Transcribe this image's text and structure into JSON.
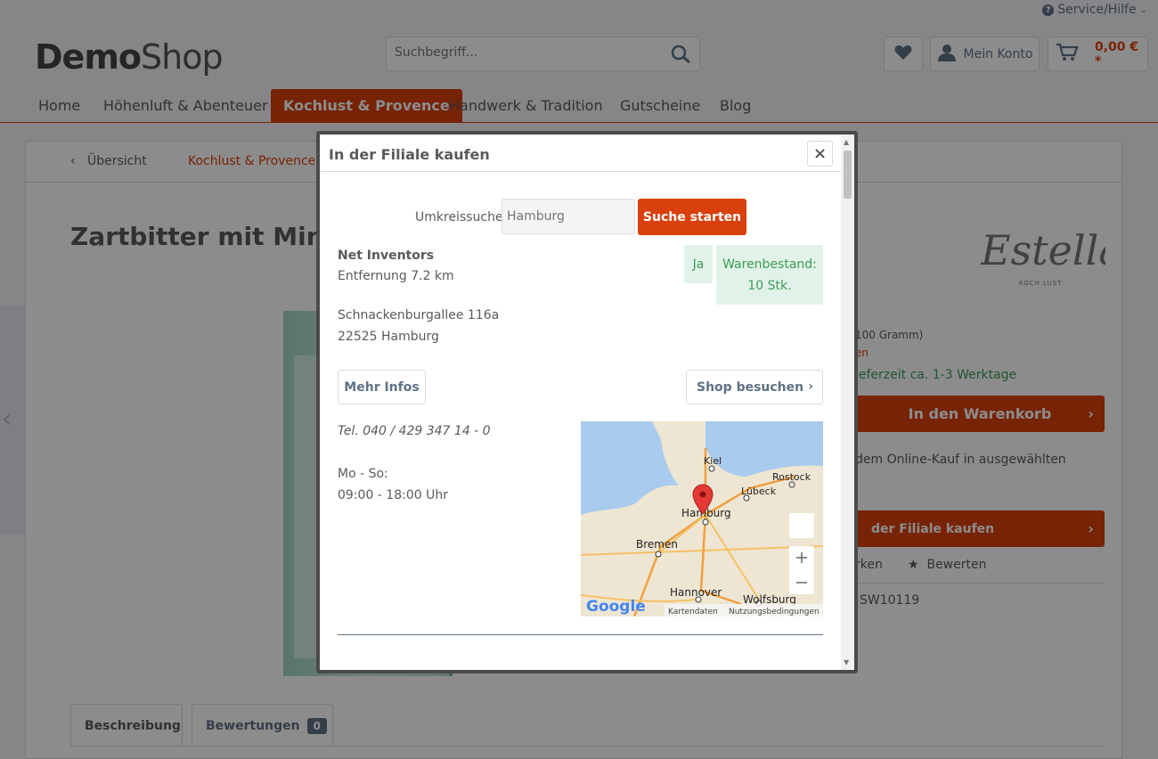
{
  "header": {
    "service_label": "Service/Hilfe",
    "logo_bold": "Demo",
    "logo_light": "Shop",
    "search_placeholder": "Suchbegriff...",
    "account_label": "Mein Konto",
    "cart_amount": "0,00 € *"
  },
  "nav": {
    "items": [
      {
        "label": "Home"
      },
      {
        "label": "Höhenluft & Abenteuer"
      },
      {
        "label": "Kochlust & Provence"
      },
      {
        "label": "Handwerk & Tradition"
      },
      {
        "label": "Gutscheine"
      },
      {
        "label": "Blog"
      }
    ],
    "active_index": 2
  },
  "breadcrumb": {
    "back_label": "Übersicht",
    "category": "Kochlust & Provence"
  },
  "product": {
    "title_visible": "Zartbitter mit Minze",
    "brand_logo_text": "Estella",
    "brand_logo_sub": "KOCH LUST",
    "unit_price_fragment": "100 Gramm)",
    "shipping_fragment": "en",
    "delivery_fragment": "ieferzeit ca. 1-3 Werktage",
    "add_to_cart": "In den Warenkorb",
    "offline_text_fragment": "dem Online-Kauf in ausgewählten",
    "store_button_fragment": "der Filiale kaufen",
    "remember_fragment": "rken",
    "rate_label": "Bewerten",
    "sku": "SW10119"
  },
  "tabs": {
    "description": "Beschreibung",
    "reviews": "Bewertungen",
    "reviews_count": "0"
  },
  "modal": {
    "title": "In der Filiale kaufen",
    "close_symbol": "×",
    "radius_label": "Umkreissuche",
    "radius_placeholder": "Hamburg",
    "search_button": "Suche starten",
    "store": {
      "name": "Net Inventors",
      "distance": "Entfernung 7.2 km",
      "available": "Ja",
      "stock_label": "Warenbestand:",
      "stock_value": "10 Stk.",
      "street": "Schnackenburgallee 116a",
      "city": "22525 Hamburg",
      "more_info": "Mehr Infos",
      "visit_shop": "Shop besuchen",
      "phone": "Tel. 040 / 429 347 14 - 0",
      "hours_label": "Mo - So:",
      "hours": "09:00 - 18:00 Uhr"
    },
    "map": {
      "cities": [
        "Kiel",
        "Rostock",
        "Lübeck",
        "Hamburg",
        "Bremen",
        "Hannover",
        "Wolfsburg"
      ],
      "google": "Google",
      "map_data": "Kartendaten",
      "terms": "Nutzungsbedingungen"
    }
  },
  "colors": {
    "accent": "#d9400b",
    "text": "#5a5a5a",
    "muted": "#5f7285",
    "success": "#3b9a5a",
    "success_bg": "#e1f3e8"
  }
}
